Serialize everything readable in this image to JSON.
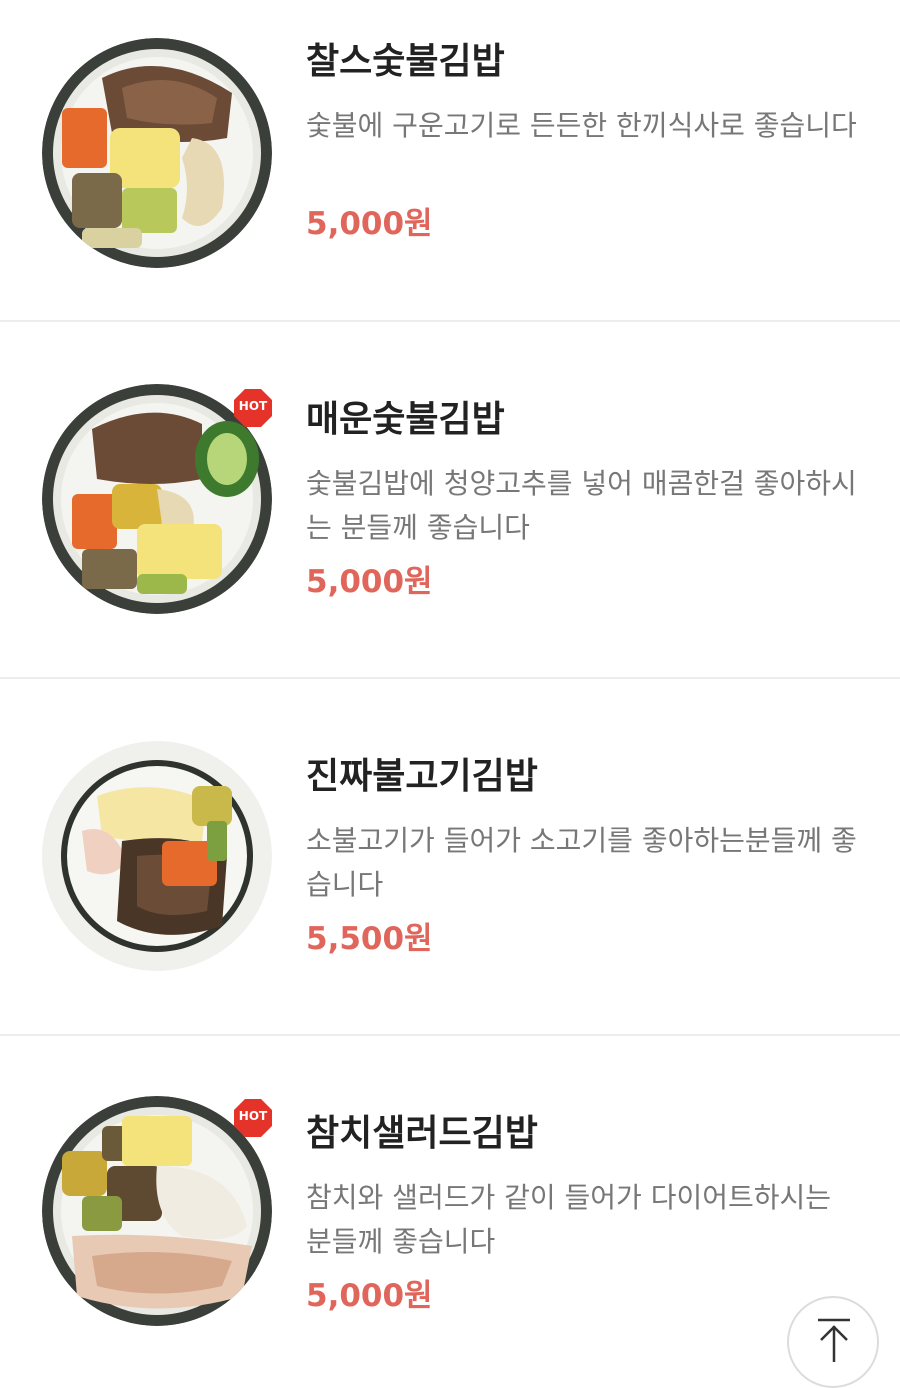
{
  "menu": {
    "items": [
      {
        "name": "찰스숯불김밥",
        "description": "숯불에 구운고기로 든든한 한끼식사로 좋습니다",
        "price": "5,000원",
        "hot": false
      },
      {
        "name": "매운숯불김밥",
        "description": "숯불김밥에 청양고추를 넣어 매콤한걸 좋아하시는 분들께 좋습니다",
        "price": "5,000원",
        "hot": true,
        "badge": "HOT"
      },
      {
        "name": "진짜불고기김밥",
        "description": "소불고기가 들어가 소고기를 좋아하는분들께 좋습니다",
        "price": "5,500원",
        "hot": false
      },
      {
        "name": "참치샐러드김밥",
        "description": "참치와 샐러드가 같이 들어가 다이어트하시는 분들께 좋습니다",
        "price": "5,000원",
        "hot": true,
        "badge": "HOT"
      }
    ]
  },
  "colors": {
    "price": "#e0665b",
    "hot_badge": "#e5332a",
    "divider": "#ececec"
  },
  "icons": {
    "scroll_top": "arrow-up-to-top-icon"
  }
}
